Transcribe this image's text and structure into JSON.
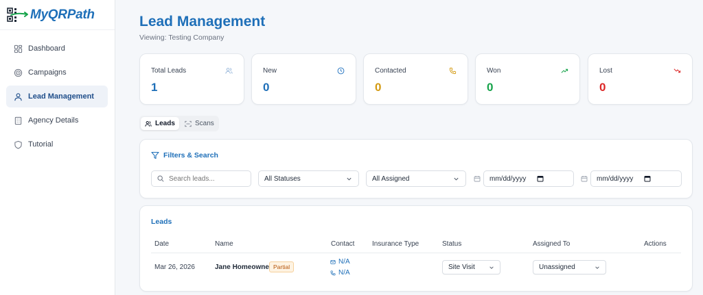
{
  "app": {
    "logo_text": "MyQRPath"
  },
  "sidebar": {
    "items": [
      {
        "label": "Dashboard",
        "icon": "dashboard-icon",
        "active": false
      },
      {
        "label": "Campaigns",
        "icon": "target-icon",
        "active": false
      },
      {
        "label": "Lead Management",
        "icon": "user-icon",
        "active": true
      },
      {
        "label": "Agency Details",
        "icon": "building-icon",
        "active": false
      },
      {
        "label": "Tutorial",
        "icon": "shield-icon",
        "active": false
      }
    ]
  },
  "header": {
    "title": "Lead Management",
    "subtitle": "Viewing: Testing Company"
  },
  "stats": [
    {
      "label": "Total Leads",
      "value": "1",
      "color": "#1e6fb8",
      "icon": "users-icon"
    },
    {
      "label": "New",
      "value": "0",
      "color": "#1e6fb8",
      "icon": "clock-icon"
    },
    {
      "label": "Contacted",
      "value": "0",
      "color": "#d39a12",
      "icon": "phone-icon"
    },
    {
      "label": "Won",
      "value": "0",
      "color": "#16a34a",
      "icon": "trending-up-icon"
    },
    {
      "label": "Lost",
      "value": "0",
      "color": "#dc2626",
      "icon": "trending-down-icon"
    }
  ],
  "tabs": [
    {
      "label": "Leads",
      "icon": "users-icon",
      "active": true
    },
    {
      "label": "Scans",
      "icon": "scan-icon",
      "active": false
    }
  ],
  "filters": {
    "title": "Filters & Search",
    "search_placeholder": "Search leads...",
    "status_value": "All Statuses",
    "assigned_value": "All Assigned",
    "date_from_placeholder": "mm/dd/yyyy",
    "date_to_placeholder": "mm/dd/yyyy"
  },
  "leads": {
    "title": "Leads",
    "columns": [
      "Date",
      "Name",
      "Contact",
      "Insurance Type",
      "Status",
      "Assigned To",
      "Actions"
    ],
    "rows": [
      {
        "date": "Mar 26, 2026",
        "name": "Jane Homeowner",
        "badge": "Partial",
        "email": "N/A",
        "phone": "N/A",
        "insurance_type": "",
        "status": "Site Visit",
        "assigned": "Unassigned"
      }
    ]
  }
}
